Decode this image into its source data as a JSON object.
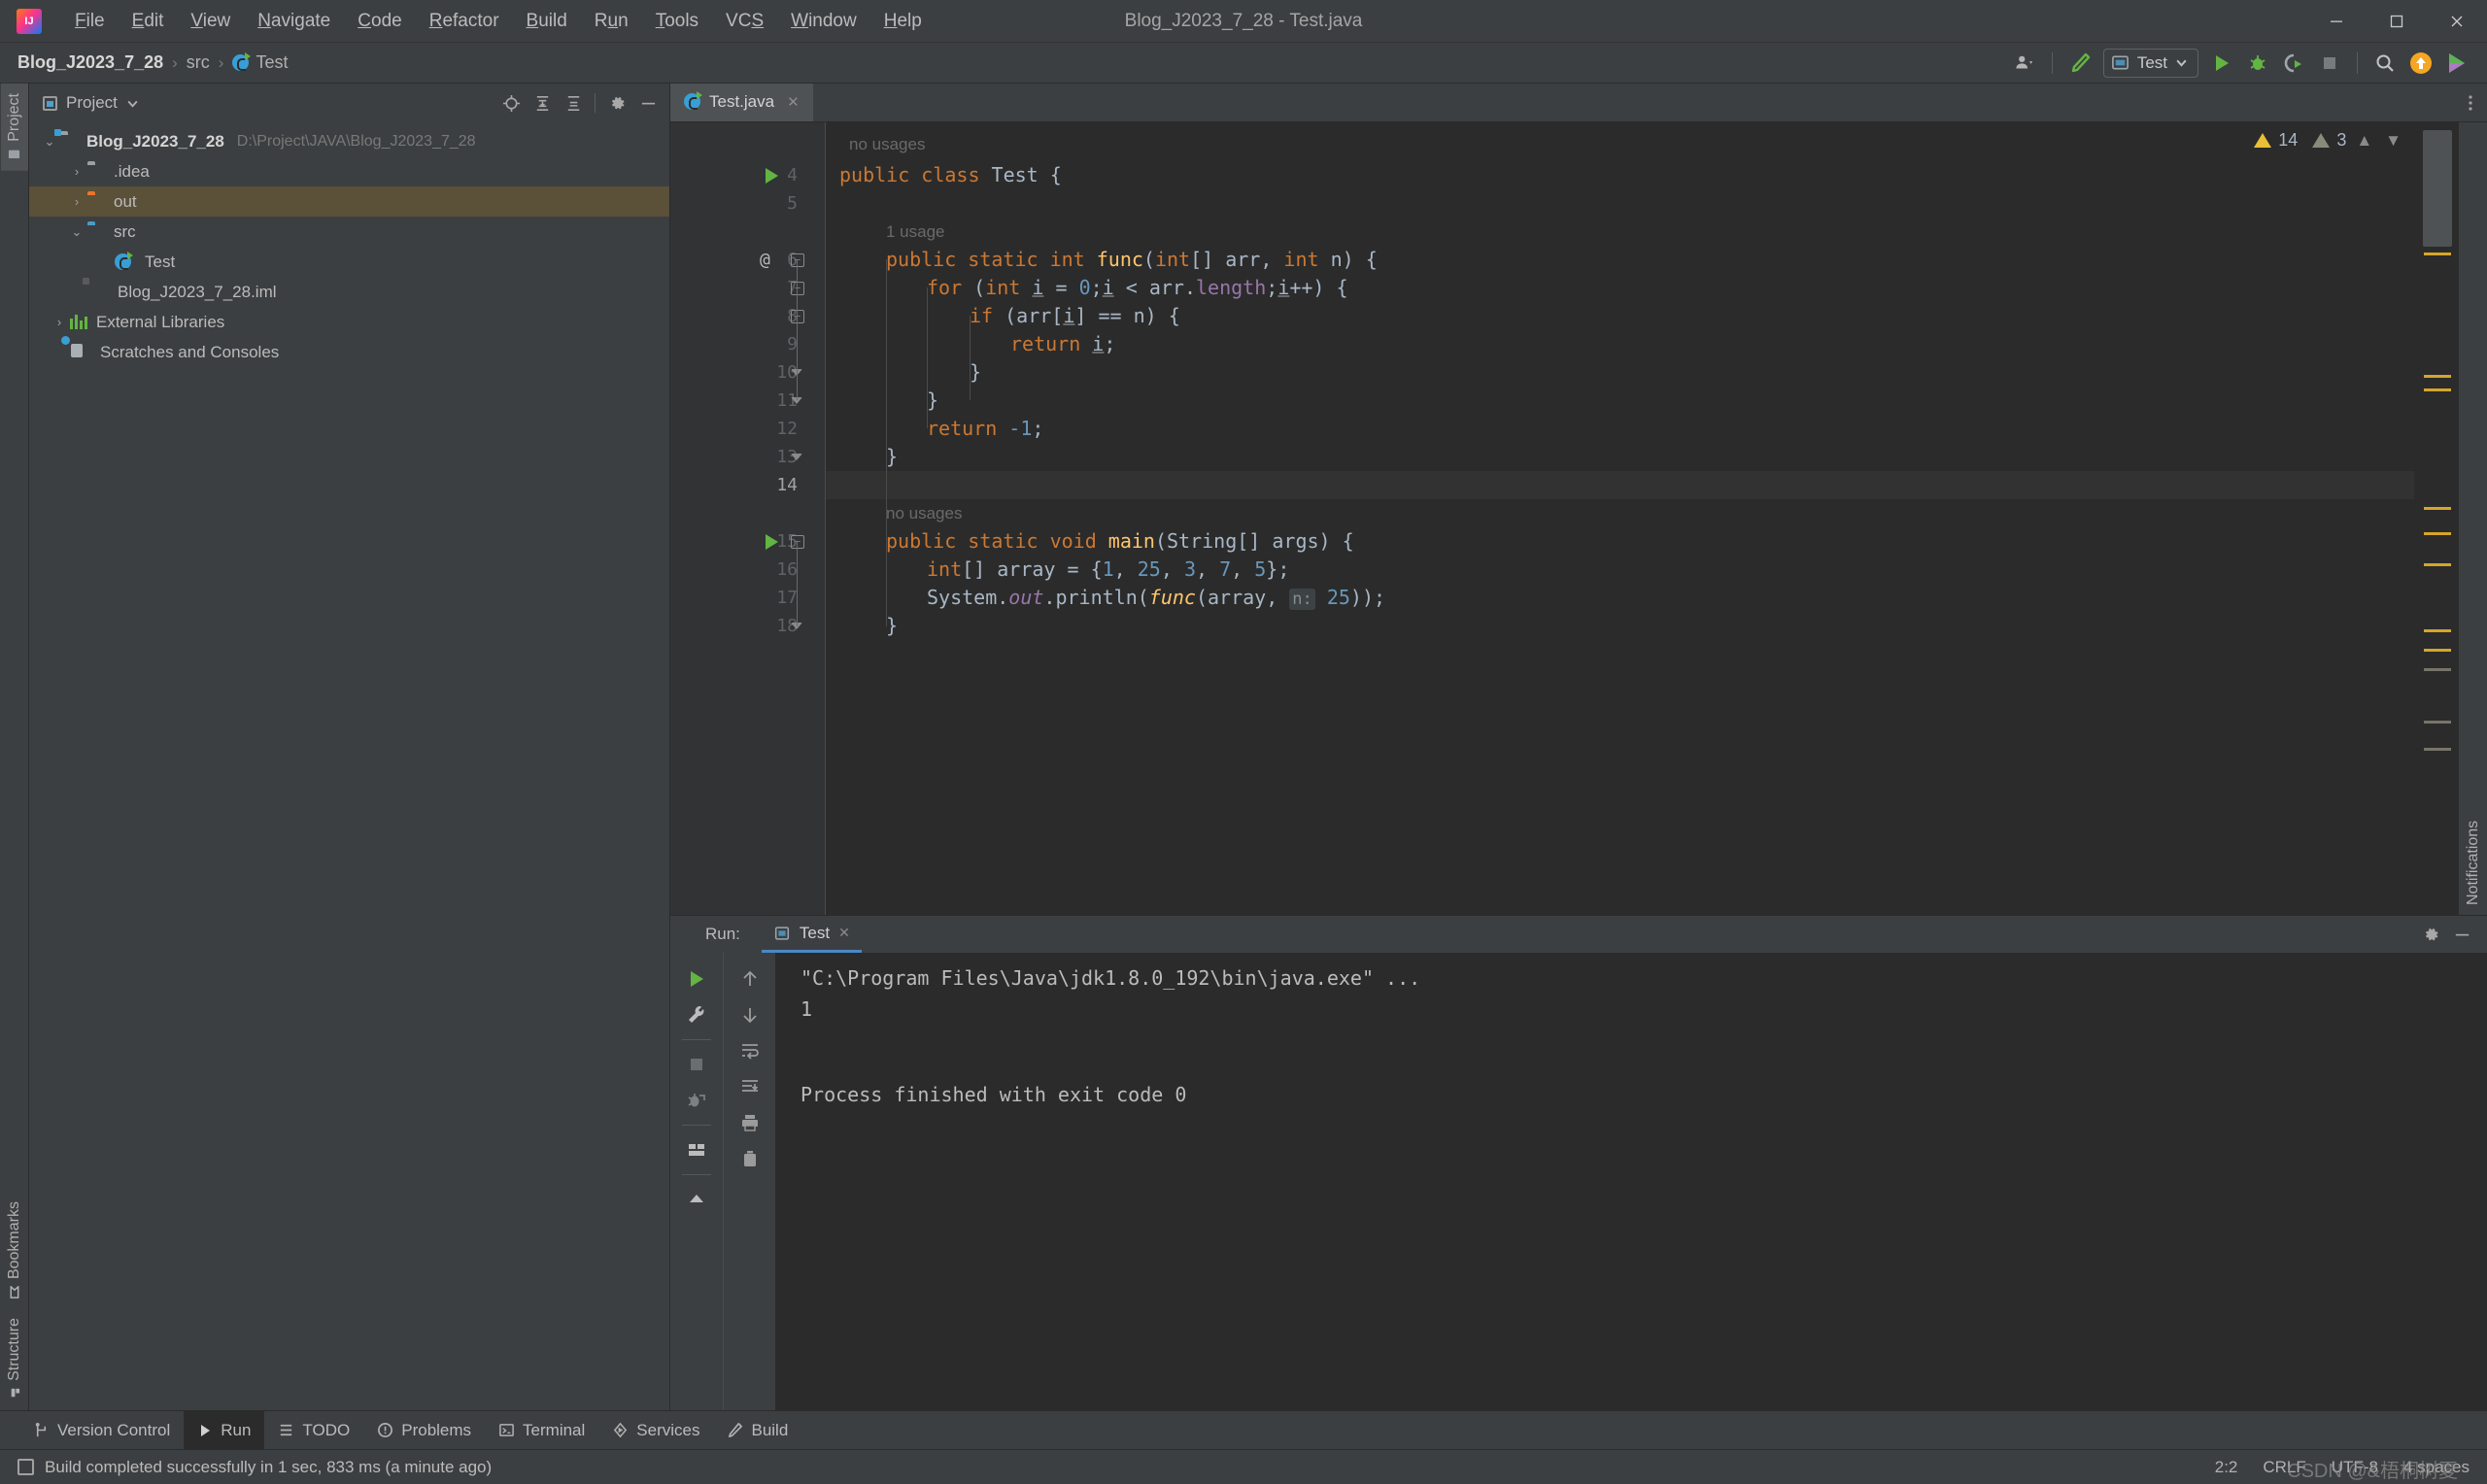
{
  "window": {
    "title": "Blog_J2023_7_28 - Test.java",
    "minimize_icon": "minimize-icon",
    "maximize_icon": "maximize-icon",
    "close_icon": "close-icon"
  },
  "menu": {
    "items": [
      {
        "label": "File",
        "mnemonic": "F"
      },
      {
        "label": "Edit",
        "mnemonic": "E"
      },
      {
        "label": "View",
        "mnemonic": "V"
      },
      {
        "label": "Navigate",
        "mnemonic": "N"
      },
      {
        "label": "Code",
        "mnemonic": "C"
      },
      {
        "label": "Refactor",
        "mnemonic": "R"
      },
      {
        "label": "Build",
        "mnemonic": "B"
      },
      {
        "label": "Run",
        "mnemonic": "u"
      },
      {
        "label": "Tools",
        "mnemonic": "T"
      },
      {
        "label": "VCS",
        "mnemonic": "S"
      },
      {
        "label": "Window",
        "mnemonic": "W"
      },
      {
        "label": "Help",
        "mnemonic": "H"
      }
    ]
  },
  "breadcrumb": {
    "project": "Blog_J2023_7_28",
    "separator": "›",
    "folder": "src",
    "file": "Test"
  },
  "toolbar": {
    "account_icon": "account-icon",
    "build_icon": "build-hammer-icon",
    "run_config": "Test",
    "run_config_icon": "run-config-icon",
    "run_icon": "run-icon",
    "debug_icon": "debug-icon",
    "coverage_icon": "run-with-coverage-icon",
    "stop_icon": "stop-icon",
    "search_icon": "search-everywhere-icon",
    "update_icon": "update-project-icon",
    "ide_icon": "ide-feature-icon"
  },
  "left_strip": {
    "tabs": [
      {
        "label": "Project",
        "icon": "project-icon",
        "active": true
      },
      {
        "label": "Bookmarks",
        "icon": "bookmarks-icon",
        "active": false
      },
      {
        "label": "Structure",
        "icon": "structure-icon",
        "active": false
      }
    ]
  },
  "right_strip": {
    "label": "Notifications"
  },
  "project_panel": {
    "title": "Project",
    "dropdown_icon": "chevron-down-icon",
    "actions": [
      {
        "name": "select-opened-file-icon"
      },
      {
        "name": "expand-all-icon"
      },
      {
        "name": "collapse-all-icon"
      },
      {
        "name": "settings-gear-icon"
      },
      {
        "name": "hide-panel-icon"
      }
    ],
    "tree": [
      {
        "label": "Blog_J2023_7_28",
        "path": "D:\\Project\\JAVA\\Blog_J2023_7_28",
        "icon": "module-folder-icon",
        "arrow": "⌄",
        "depth": 0,
        "bold": true,
        "selected": false
      },
      {
        "label": ".idea",
        "path": "",
        "icon": "folder-gray-icon",
        "arrow": "›",
        "depth": 1,
        "bold": false,
        "selected": false
      },
      {
        "label": "out",
        "path": "",
        "icon": "folder-orange-icon",
        "arrow": "›",
        "depth": 1,
        "bold": false,
        "selected": true
      },
      {
        "label": "src",
        "path": "",
        "icon": "folder-blue-icon",
        "arrow": "⌄",
        "depth": 1,
        "bold": false,
        "selected": false
      },
      {
        "label": "Test",
        "path": "",
        "icon": "java-class-icon",
        "arrow": "",
        "depth": 2,
        "bold": false,
        "selected": false
      },
      {
        "label": "Blog_J2023_7_28.iml",
        "path": "",
        "icon": "iml-file-icon",
        "arrow": "",
        "depth": 1,
        "bold": false,
        "selected": false
      },
      {
        "label": "External Libraries",
        "path": "",
        "icon": "libraries-icon",
        "arrow": "›",
        "depth": 0,
        "bold": false,
        "selected": false
      },
      {
        "label": "Scratches and Consoles",
        "path": "",
        "icon": "scratches-icon",
        "arrow": "",
        "depth": 0,
        "bold": false,
        "selected": false
      }
    ]
  },
  "editor": {
    "tab": {
      "label": "Test.java",
      "icon": "java-class-icon",
      "close_icon": "close-icon"
    },
    "more_tabs_icon": "more-options-icon",
    "inspections": {
      "warning_count": "14",
      "weak_warning_count": "3",
      "warning_icon": "warning-triangle-icon",
      "weak_warning_icon": "weak-warning-triangle-icon",
      "prev_icon": "chevron-up-icon",
      "next_icon": "chevron-down-icon"
    },
    "current_line": 14,
    "lines": [
      {
        "num": "",
        "text": "no usages",
        "kind": "hint",
        "indent": 1
      },
      {
        "num": "4",
        "text": "public class Test {",
        "kind": "code",
        "gutter_run": true
      },
      {
        "num": "5",
        "text": "",
        "kind": "code"
      },
      {
        "num": "",
        "text": "1 usage",
        "kind": "hint",
        "indent": 2
      },
      {
        "num": "6",
        "text": "public static int func(int[] arr, int n) {",
        "kind": "code",
        "annotation": "@",
        "fold": "open"
      },
      {
        "num": "7",
        "text": "for (int i = 0;i < arr.length;i++) {",
        "kind": "code",
        "fold": "open"
      },
      {
        "num": "8",
        "text": "if (arr[i] == n) {",
        "kind": "code",
        "fold": "open"
      },
      {
        "num": "9",
        "text": "return i;",
        "kind": "code"
      },
      {
        "num": "10",
        "text": "}",
        "kind": "code",
        "fold": "end"
      },
      {
        "num": "11",
        "text": "}",
        "kind": "code",
        "fold": "end"
      },
      {
        "num": "12",
        "text": "return -1;",
        "kind": "code"
      },
      {
        "num": "13",
        "text": "}",
        "kind": "code",
        "fold": "end"
      },
      {
        "num": "14",
        "text": "",
        "kind": "code"
      },
      {
        "num": "",
        "text": "no usages",
        "kind": "hint",
        "indent": 2
      },
      {
        "num": "15",
        "text": "public static void main(String[] args) {",
        "kind": "code",
        "gutter_run": true,
        "fold": "open"
      },
      {
        "num": "16",
        "text": "int[] array = {1, 25, 3, 7, 5};",
        "kind": "code"
      },
      {
        "num": "17",
        "text": "System.out.println(func(array, n: 25));",
        "kind": "code"
      },
      {
        "num": "18",
        "text": "}",
        "kind": "code",
        "fold": "end"
      }
    ]
  },
  "run_panel": {
    "label": "Run:",
    "tab": {
      "label": "Test",
      "icon": "run-config-icon",
      "close_icon": "close-icon"
    },
    "header_actions": [
      {
        "name": "settings-gear-icon"
      },
      {
        "name": "hide-panel-icon"
      }
    ],
    "tools_left": [
      {
        "name": "rerun-icon"
      },
      {
        "name": "edit-configurations-wrench-icon"
      },
      {
        "name": "stop-icon"
      },
      {
        "name": "rerun-failed-icon"
      },
      {
        "name": "layout-settings-icon"
      },
      {
        "name": "pin-tab-icon"
      }
    ],
    "tools_right": [
      {
        "name": "scroll-up-icon"
      },
      {
        "name": "scroll-down-icon"
      },
      {
        "name": "soft-wrap-icon"
      },
      {
        "name": "scroll-to-end-icon"
      },
      {
        "name": "print-icon"
      },
      {
        "name": "clear-all-icon"
      }
    ],
    "console": [
      {
        "text": "\"C:\\Program Files\\Java\\jdk1.8.0_192\\bin\\java.exe\" ...",
        "highlight": true
      },
      {
        "text": "1",
        "highlight": false
      },
      {
        "text": "",
        "highlight": false
      },
      {
        "text": "Process finished with exit code 0",
        "highlight": false
      }
    ]
  },
  "toolwindow_bar": {
    "items": [
      {
        "label": "Version Control",
        "icon": "version-control-icon",
        "active": false
      },
      {
        "label": "Run",
        "icon": "run-icon",
        "active": true
      },
      {
        "label": "TODO",
        "icon": "todo-icon",
        "active": false
      },
      {
        "label": "Problems",
        "icon": "problems-icon",
        "active": false
      },
      {
        "label": "Terminal",
        "icon": "terminal-icon",
        "active": false
      },
      {
        "label": "Services",
        "icon": "services-icon",
        "active": false
      },
      {
        "label": "Build",
        "icon": "build-hammer-icon",
        "active": false
      }
    ]
  },
  "status_bar": {
    "icon": "event-log-icon",
    "message": "Build completed successfully in 1 sec, 833 ms (a minute ago)",
    "caret_position": "2:2",
    "line_separator": "CRLF",
    "encoding": "UTF-8",
    "indent": "4 spaces",
    "watermark": "CSDN @&梧桐树夏"
  },
  "colors": {
    "background": "#3c3f41",
    "editor_background": "#2b2b2b",
    "keyword": "#cc7832",
    "method": "#ffc66d",
    "number": "#6897bb",
    "field": "#9876aa",
    "text": "#a9b7c6",
    "accent_green": "#62b543",
    "accent_blue": "#4a88c7",
    "selection": "#5b5038",
    "warning": "#e8bf36"
  }
}
